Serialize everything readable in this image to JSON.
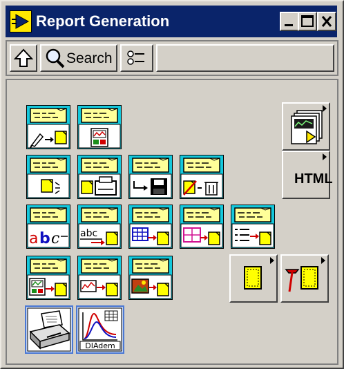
{
  "window": {
    "title": "Report Generation"
  },
  "toolbar": {
    "search_label": "Search"
  },
  "palette": {
    "html_label": "HTML",
    "diadem_label": "DIAdem"
  },
  "icons": {
    "header": "yellow-report-header",
    "colors": {
      "title_bar": "#0a246a",
      "report_cyan": "#14c8dc",
      "report_yellow": "#ffff00",
      "highlight": "#4a78d4"
    }
  }
}
